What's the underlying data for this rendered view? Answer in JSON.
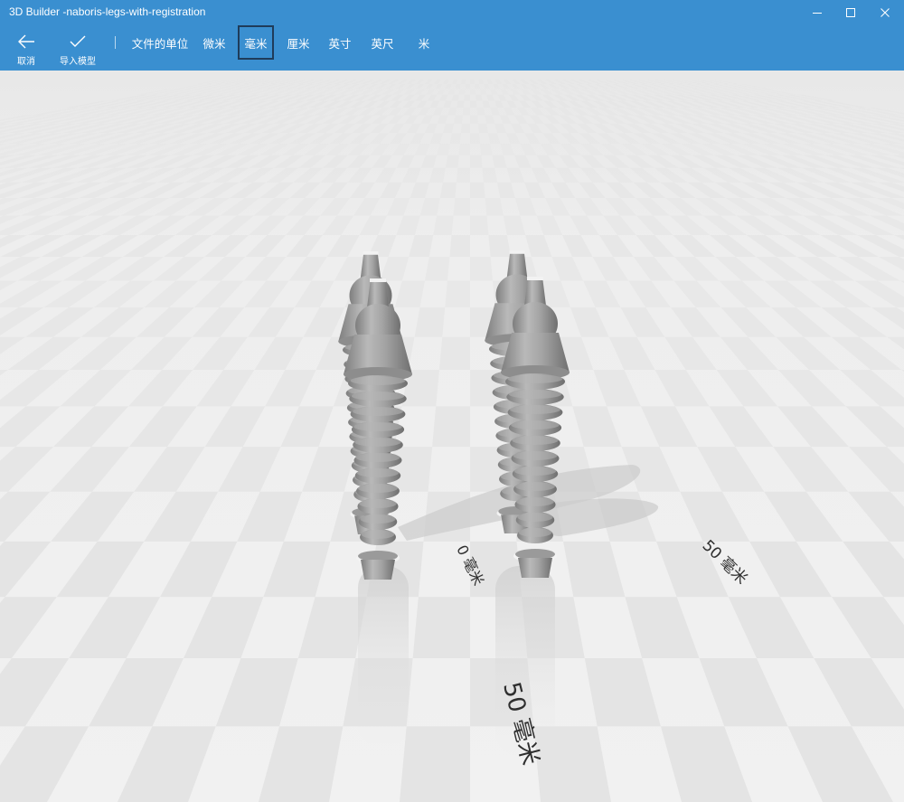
{
  "window": {
    "title": "3D Builder -naboris-legs-with-registration"
  },
  "toolbar": {
    "cancel_label": "取消",
    "import_label": "导入模型",
    "units_heading": "文件的单位",
    "units": [
      {
        "label": "微米",
        "selected": false
      },
      {
        "label": "毫米",
        "selected": true
      },
      {
        "label": "厘米",
        "selected": false
      },
      {
        "label": "英寸",
        "selected": false
      },
      {
        "label": "英尺",
        "selected": false
      },
      {
        "label": "米",
        "selected": false
      }
    ]
  },
  "viewport": {
    "scale_labels": {
      "origin": "0 毫米",
      "right": "50 毫米",
      "front": "50 毫米"
    }
  },
  "colors": {
    "accent": "#3a8fd0",
    "selected_border": "#1f3c5a",
    "model_gray": "#9c9c9c",
    "floor_light": "#f4f4f4",
    "floor_dark": "#e4e4e4"
  },
  "icons": {
    "cancel": "arrow-left-icon",
    "import": "checkmark-icon",
    "minimize": "minimize-icon",
    "maximize": "maximize-icon",
    "close": "close-icon"
  }
}
